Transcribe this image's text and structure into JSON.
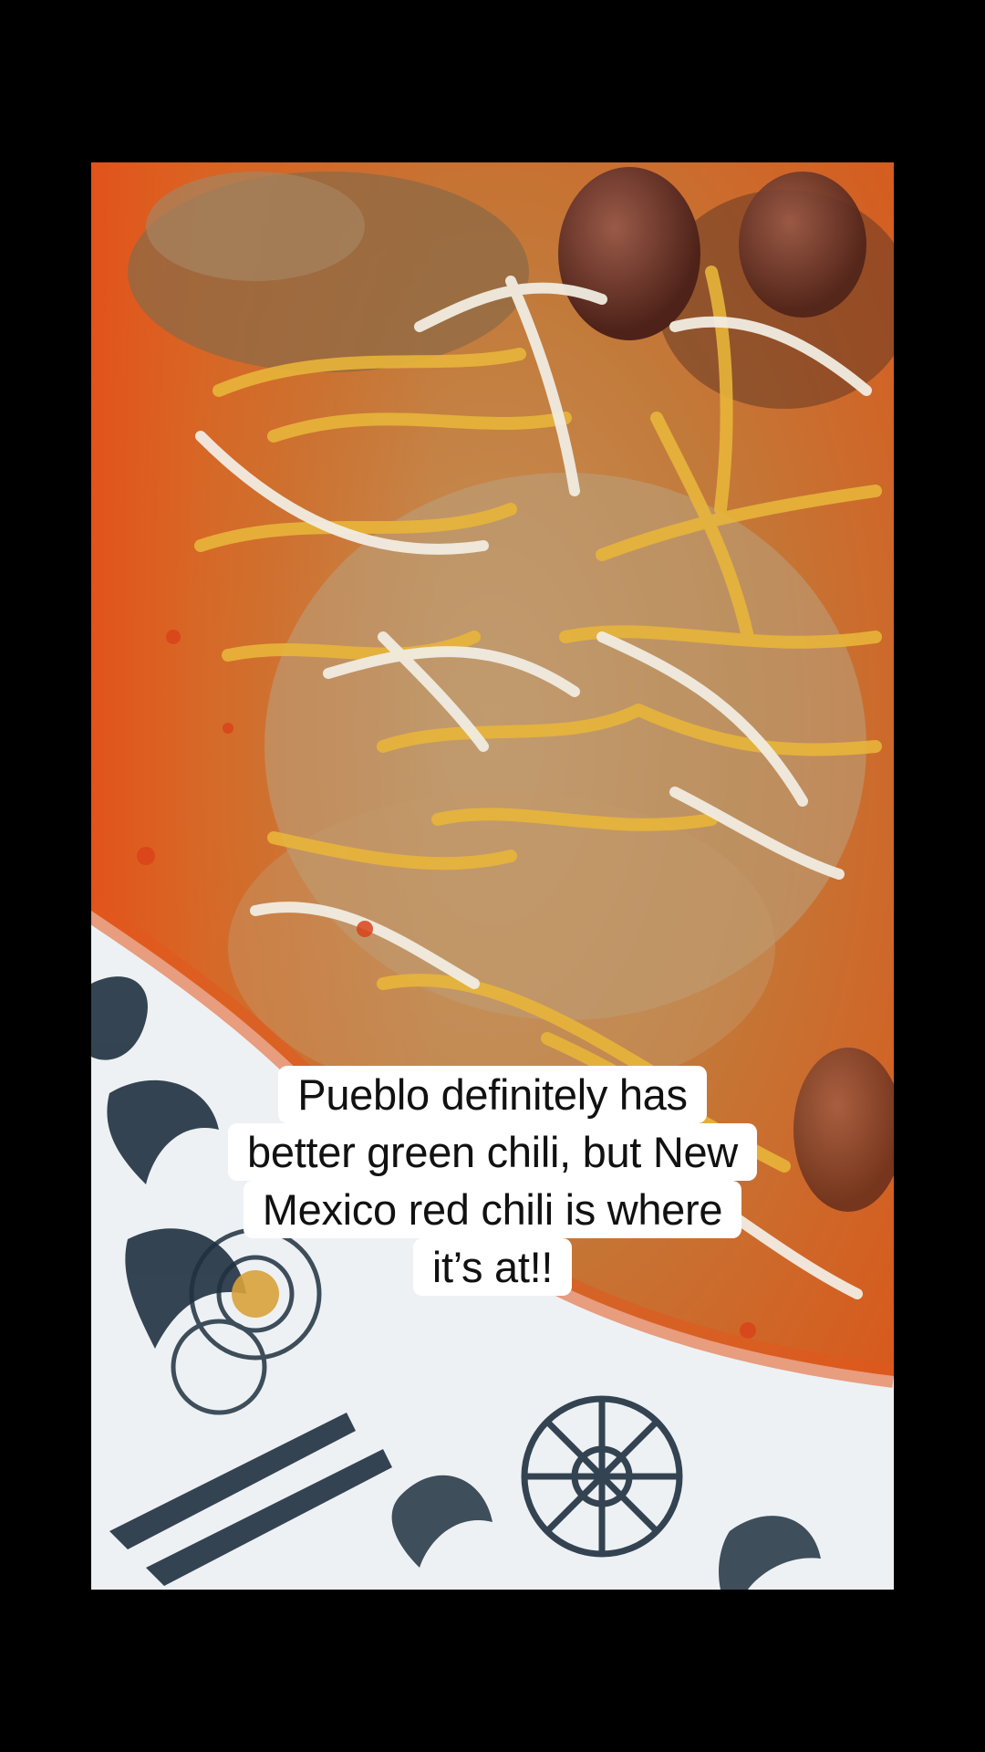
{
  "screen": {
    "background": "#000000"
  },
  "video": {
    "subject": "bowl-of-red-chili-with-shredded-cheese",
    "colors": {
      "broth": "#c96a22",
      "chili_red": "#e2531b",
      "cheese_yellow": "#e8b53a",
      "cheese_white": "#f1ece1",
      "bean": "#6e3326",
      "plate_white": "#eef1f4",
      "plate_pattern": "#1f3140"
    }
  },
  "caption": {
    "lines": [
      "Pueblo definitely has",
      "better green chili, but New",
      "Mexico red chili is where",
      "it’s at!!"
    ],
    "background": "#ffffff",
    "text_color": "#111111"
  }
}
